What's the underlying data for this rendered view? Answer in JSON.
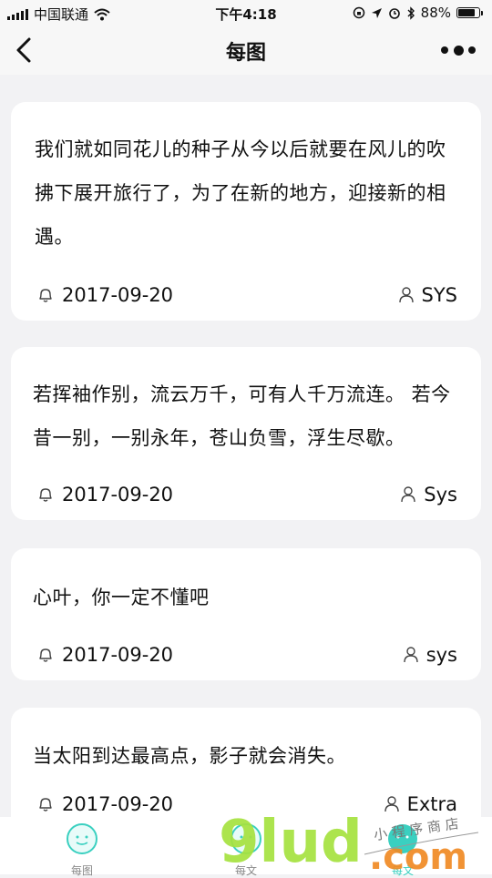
{
  "status_bar": {
    "carrier": "中国联通",
    "time": "下午4:18",
    "battery": "88%",
    "battery_level": 0.88
  },
  "nav": {
    "title": "每图",
    "back_icon": "chevron-left-icon",
    "more_icon": "more-dots-icon"
  },
  "cards": [
    {
      "text": "我们就如同花儿的种子从今以后就要在风儿的吹拂下展开旅行了，为了在新的地方，迎接新的相遇。",
      "date": "2017-09-20",
      "author": "SYS"
    },
    {
      "text": "若挥袖作别，流云万千，可有人千万流连。 若今昔一别，一别永年，苍山负雪，浮生尽歇。",
      "date": "2017-09-20",
      "author": "Sys"
    },
    {
      "text": "心叶，你一定不懂吧",
      "date": "2017-09-20",
      "author": "sys"
    },
    {
      "text": "当太阳到达最高点，影子就会消失。",
      "date": "2017-09-20",
      "author": "Extra"
    }
  ],
  "tabs": [
    {
      "label": "每图",
      "active": false
    },
    {
      "label": "每文",
      "active": false
    },
    {
      "label": "每文",
      "active": true
    }
  ],
  "watermark": {
    "brand": "9lud.com",
    "tagline": "小程序商店"
  },
  "colors": {
    "accent": "#3ad0c0",
    "watermark_green": "#a6e23f",
    "watermark_orange": "#f08a24"
  }
}
